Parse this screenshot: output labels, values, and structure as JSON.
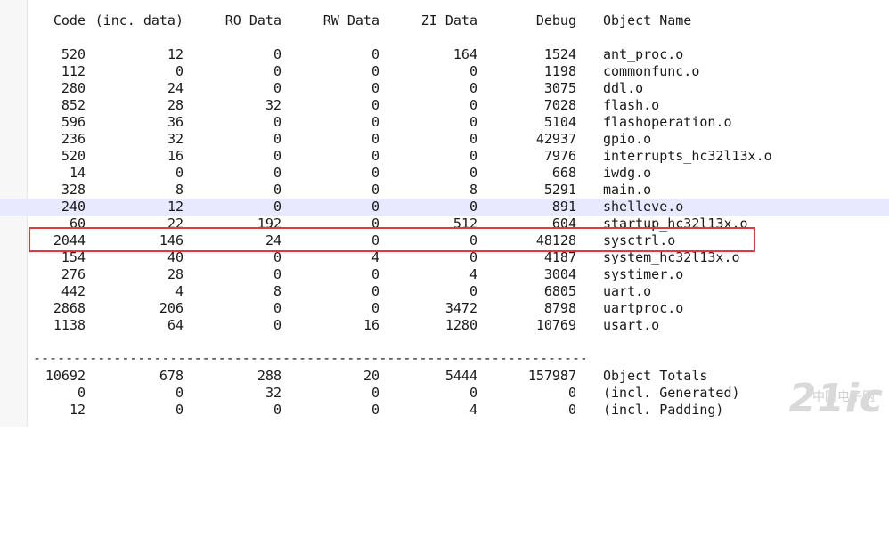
{
  "header": {
    "code": "Code",
    "inc_data": "(inc. data)",
    "ro_data": "RO Data",
    "rw_data": "RW Data",
    "zi_data": "ZI Data",
    "debug": "Debug",
    "object_name": "Object Name"
  },
  "rows": [
    {
      "code": "520",
      "inc": "12",
      "ro": "0",
      "rw": "0",
      "zi": "164",
      "debug": "1524",
      "name": "ant_proc.o"
    },
    {
      "code": "112",
      "inc": "0",
      "ro": "0",
      "rw": "0",
      "zi": "0",
      "debug": "1198",
      "name": "commonfunc.o"
    },
    {
      "code": "280",
      "inc": "24",
      "ro": "0",
      "rw": "0",
      "zi": "0",
      "debug": "3075",
      "name": "ddl.o"
    },
    {
      "code": "852",
      "inc": "28",
      "ro": "32",
      "rw": "0",
      "zi": "0",
      "debug": "7028",
      "name": "flash.o"
    },
    {
      "code": "596",
      "inc": "36",
      "ro": "0",
      "rw": "0",
      "zi": "0",
      "debug": "5104",
      "name": "flashoperation.o"
    },
    {
      "code": "236",
      "inc": "32",
      "ro": "0",
      "rw": "0",
      "zi": "0",
      "debug": "42937",
      "name": "gpio.o"
    },
    {
      "code": "520",
      "inc": "16",
      "ro": "0",
      "rw": "0",
      "zi": "0",
      "debug": "7976",
      "name": "interrupts_hc32l13x.o"
    },
    {
      "code": "14",
      "inc": "0",
      "ro": "0",
      "rw": "0",
      "zi": "0",
      "debug": "668",
      "name": "iwdg.o"
    },
    {
      "code": "328",
      "inc": "8",
      "ro": "0",
      "rw": "0",
      "zi": "8",
      "debug": "5291",
      "name": "main.o"
    },
    {
      "code": "240",
      "inc": "12",
      "ro": "0",
      "rw": "0",
      "zi": "0",
      "debug": "891",
      "name": "shelleve.o"
    },
    {
      "code": "60",
      "inc": "22",
      "ro": "192",
      "rw": "0",
      "zi": "512",
      "debug": "604",
      "name": "startup_hc32l13x.o"
    },
    {
      "code": "2044",
      "inc": "146",
      "ro": "24",
      "rw": "0",
      "zi": "0",
      "debug": "48128",
      "name": "sysctrl.o"
    },
    {
      "code": "154",
      "inc": "40",
      "ro": "0",
      "rw": "4",
      "zi": "0",
      "debug": "4187",
      "name": "system_hc32l13x.o"
    },
    {
      "code": "276",
      "inc": "28",
      "ro": "0",
      "rw": "0",
      "zi": "4",
      "debug": "3004",
      "name": "systimer.o"
    },
    {
      "code": "442",
      "inc": "4",
      "ro": "8",
      "rw": "0",
      "zi": "0",
      "debug": "6805",
      "name": "uart.o"
    },
    {
      "code": "2868",
      "inc": "206",
      "ro": "0",
      "rw": "0",
      "zi": "3472",
      "debug": "8798",
      "name": "uartproc.o"
    },
    {
      "code": "1138",
      "inc": "64",
      "ro": "0",
      "rw": "16",
      "zi": "1280",
      "debug": "10769",
      "name": "usart.o"
    }
  ],
  "separator": "------------------------------------------------------------------------",
  "totals": [
    {
      "code": "10692",
      "inc": "678",
      "ro": "288",
      "rw": "20",
      "zi": "5444",
      "debug": "157987",
      "name": "Object Totals"
    },
    {
      "code": "0",
      "inc": "0",
      "ro": "32",
      "rw": "0",
      "zi": "0",
      "debug": "0",
      "name": "(incl. Generated)"
    },
    {
      "code": "12",
      "inc": "0",
      "ro": "0",
      "rw": "0",
      "zi": "4",
      "debug": "0",
      "name": "(incl. Padding)"
    }
  ],
  "watermark": {
    "logo": "21ic",
    "sub": "中国电子网"
  },
  "colors": {
    "highlight_box": "#e03a3a",
    "selected_line": "#e8e8ff"
  }
}
